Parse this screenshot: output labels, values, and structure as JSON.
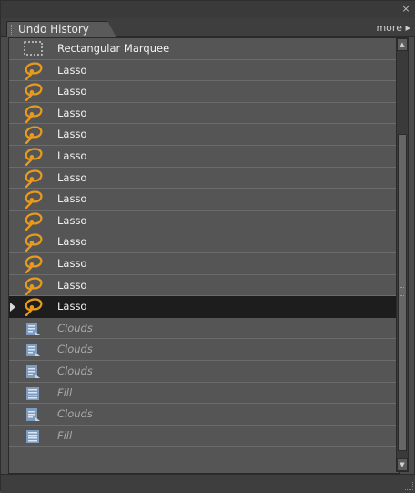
{
  "panel": {
    "tab_label": "Undo History",
    "more_label": "more",
    "more_arrow": "▸",
    "close_glyph": "×"
  },
  "scrollbar": {
    "up_glyph": "▲",
    "down_glyph": "▼"
  },
  "history": [
    {
      "label": "Rectangular Marquee",
      "icon": "marquee-icon",
      "state": "past"
    },
    {
      "label": "Lasso",
      "icon": "lasso-icon",
      "state": "past"
    },
    {
      "label": "Lasso",
      "icon": "lasso-icon",
      "state": "past"
    },
    {
      "label": "Lasso",
      "icon": "lasso-icon",
      "state": "past"
    },
    {
      "label": "Lasso",
      "icon": "lasso-icon",
      "state": "past"
    },
    {
      "label": "Lasso",
      "icon": "lasso-icon",
      "state": "past"
    },
    {
      "label": "Lasso",
      "icon": "lasso-icon",
      "state": "past"
    },
    {
      "label": "Lasso",
      "icon": "lasso-icon",
      "state": "past"
    },
    {
      "label": "Lasso",
      "icon": "lasso-icon",
      "state": "past"
    },
    {
      "label": "Lasso",
      "icon": "lasso-icon",
      "state": "past"
    },
    {
      "label": "Lasso",
      "icon": "lasso-icon",
      "state": "past"
    },
    {
      "label": "Lasso",
      "icon": "lasso-icon",
      "state": "past"
    },
    {
      "label": "Lasso",
      "icon": "lasso-icon",
      "state": "current"
    },
    {
      "label": "Clouds",
      "icon": "filter-icon",
      "state": "future"
    },
    {
      "label": "Clouds",
      "icon": "filter-icon",
      "state": "future"
    },
    {
      "label": "Clouds",
      "icon": "filter-icon",
      "state": "future"
    },
    {
      "label": "Fill",
      "icon": "fill-icon",
      "state": "future"
    },
    {
      "label": "Clouds",
      "icon": "filter-icon",
      "state": "future"
    },
    {
      "label": "Fill",
      "icon": "fill-icon",
      "state": "future"
    }
  ],
  "colors": {
    "panel_bg": "#4b4b4b",
    "selected_row": "#1d1d1d",
    "lasso_orange": "#e89a1c",
    "doc_icon_blue": "#7f9bbd"
  }
}
